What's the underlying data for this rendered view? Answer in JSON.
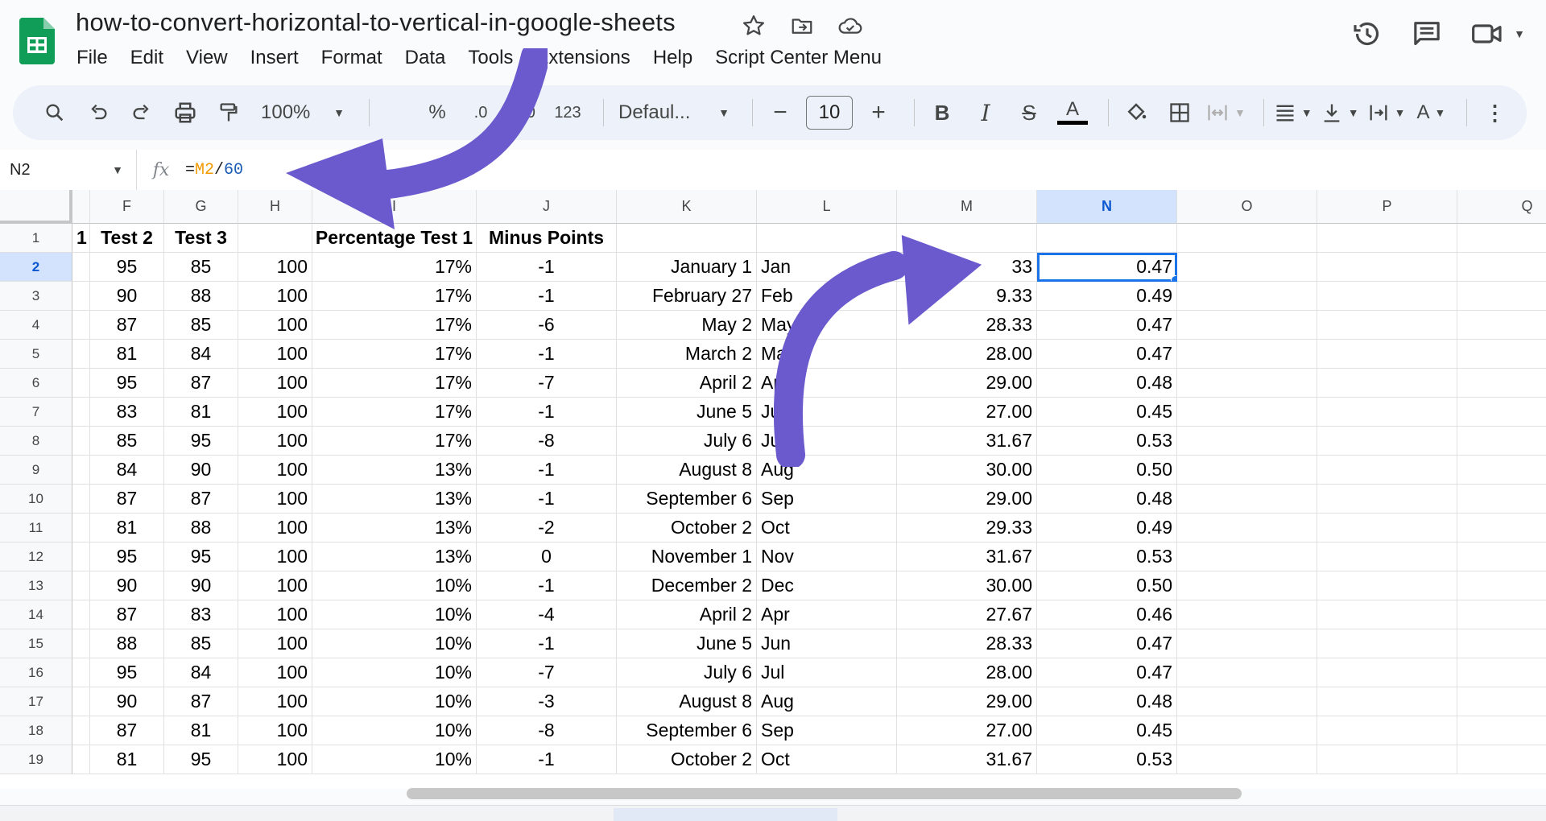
{
  "title": "how-to-convert-horizontal-to-vertical-in-google-sheets",
  "menu": [
    "File",
    "Edit",
    "View",
    "Insert",
    "Format",
    "Data",
    "Tools",
    "Extensions",
    "Help",
    "Script Center Menu"
  ],
  "toolbar": {
    "zoom": "100%",
    "percent": "%",
    "dec_less": ".0",
    "dec_more": ".00",
    "number_format": "123",
    "font": "Defaul...",
    "font_size": "10"
  },
  "namebox": "N2",
  "formula": {
    "eq": "=",
    "ref": "M2",
    "op": "/",
    "num": "60"
  },
  "columns": [
    "",
    "F",
    "G",
    "H",
    "I",
    "J",
    "K",
    "L",
    "M",
    "N",
    "O",
    "P",
    "Q"
  ],
  "selected_column": "N",
  "header_row": {
    "E": "1",
    "F": "Test 2",
    "G": "Test 3",
    "H": "",
    "I": "Percentage Test 1",
    "J": "Minus Points"
  },
  "rows": [
    {
      "n": "2",
      "F": "95",
      "G": "85",
      "H": "100",
      "I": "17%",
      "J": "-1",
      "K": "January 1",
      "L": "Jan",
      "M": "33",
      "N": "0.47"
    },
    {
      "n": "3",
      "F": "90",
      "G": "88",
      "H": "100",
      "I": "17%",
      "J": "-1",
      "K": "February 27",
      "L": "Feb",
      "M": "9.33",
      "N": "0.49"
    },
    {
      "n": "4",
      "F": "87",
      "G": "85",
      "H": "100",
      "I": "17%",
      "J": "-6",
      "K": "May 2",
      "L": "May",
      "M": "28.33",
      "N": "0.47"
    },
    {
      "n": "5",
      "F": "81",
      "G": "84",
      "H": "100",
      "I": "17%",
      "J": "-1",
      "K": "March 2",
      "L": "Mar",
      "M": "28.00",
      "N": "0.47"
    },
    {
      "n": "6",
      "F": "95",
      "G": "87",
      "H": "100",
      "I": "17%",
      "J": "-7",
      "K": "April 2",
      "L": "Apr",
      "M": "29.00",
      "N": "0.48"
    },
    {
      "n": "7",
      "F": "83",
      "G": "81",
      "H": "100",
      "I": "17%",
      "J": "-1",
      "K": "June 5",
      "L": "Jun",
      "M": "27.00",
      "N": "0.45"
    },
    {
      "n": "8",
      "F": "85",
      "G": "95",
      "H": "100",
      "I": "17%",
      "J": "-8",
      "K": "July 6",
      "L": "Jul",
      "M": "31.67",
      "N": "0.53"
    },
    {
      "n": "9",
      "F": "84",
      "G": "90",
      "H": "100",
      "I": "13%",
      "J": "-1",
      "K": "August 8",
      "L": "Aug",
      "M": "30.00",
      "N": "0.50"
    },
    {
      "n": "10",
      "F": "87",
      "G": "87",
      "H": "100",
      "I": "13%",
      "J": "-1",
      "K": "September 6",
      "L": "Sep",
      "M": "29.00",
      "N": "0.48"
    },
    {
      "n": "11",
      "F": "81",
      "G": "88",
      "H": "100",
      "I": "13%",
      "J": "-2",
      "K": "October 2",
      "L": "Oct",
      "M": "29.33",
      "N": "0.49"
    },
    {
      "n": "12",
      "F": "95",
      "G": "95",
      "H": "100",
      "I": "13%",
      "J": "0",
      "K": "November 1",
      "L": "Nov",
      "M": "31.67",
      "N": "0.53"
    },
    {
      "n": "13",
      "F": "90",
      "G": "90",
      "H": "100",
      "I": "10%",
      "J": "-1",
      "K": "December 2",
      "L": "Dec",
      "M": "30.00",
      "N": "0.50"
    },
    {
      "n": "14",
      "F": "87",
      "G": "83",
      "H": "100",
      "I": "10%",
      "J": "-4",
      "K": "April 2",
      "L": "Apr",
      "M": "27.67",
      "N": "0.46"
    },
    {
      "n": "15",
      "F": "88",
      "G": "85",
      "H": "100",
      "I": "10%",
      "J": "-1",
      "K": "June 5",
      "L": "Jun",
      "M": "28.33",
      "N": "0.47"
    },
    {
      "n": "16",
      "F": "95",
      "G": "84",
      "H": "100",
      "I": "10%",
      "J": "-7",
      "K": "July 6",
      "L": "Jul",
      "M": "28.00",
      "N": "0.47"
    },
    {
      "n": "17",
      "F": "90",
      "G": "87",
      "H": "100",
      "I": "10%",
      "J": "-3",
      "K": "August 8",
      "L": "Aug",
      "M": "29.00",
      "N": "0.48"
    },
    {
      "n": "18",
      "F": "87",
      "G": "81",
      "H": "100",
      "I": "10%",
      "J": "-8",
      "K": "September 6",
      "L": "Sep",
      "M": "27.00",
      "N": "0.45"
    },
    {
      "n": "19",
      "F": "81",
      "G": "95",
      "H": "100",
      "I": "10%",
      "J": "-1",
      "K": "October 2",
      "L": "Oct",
      "M": "31.67",
      "N": "0.53"
    }
  ],
  "colors": {
    "accent": "#1a73e8",
    "arrow": "#6a5acd",
    "sheets_green": "#0f9d58"
  },
  "icons": [
    "sheets-logo-icon",
    "star-icon",
    "move-folder-icon",
    "cloud-saved-icon",
    "history-icon",
    "comment-icon",
    "video-call-icon",
    "search-icon",
    "undo-icon",
    "redo-icon",
    "print-icon",
    "paint-format-icon",
    "bold-icon",
    "italic-icon",
    "strikethrough-icon",
    "text-color-icon",
    "fill-color-icon",
    "borders-icon",
    "merge-icon",
    "align-icon",
    "valign-icon",
    "wrap-icon",
    "rotate-icon",
    "more-icon"
  ]
}
